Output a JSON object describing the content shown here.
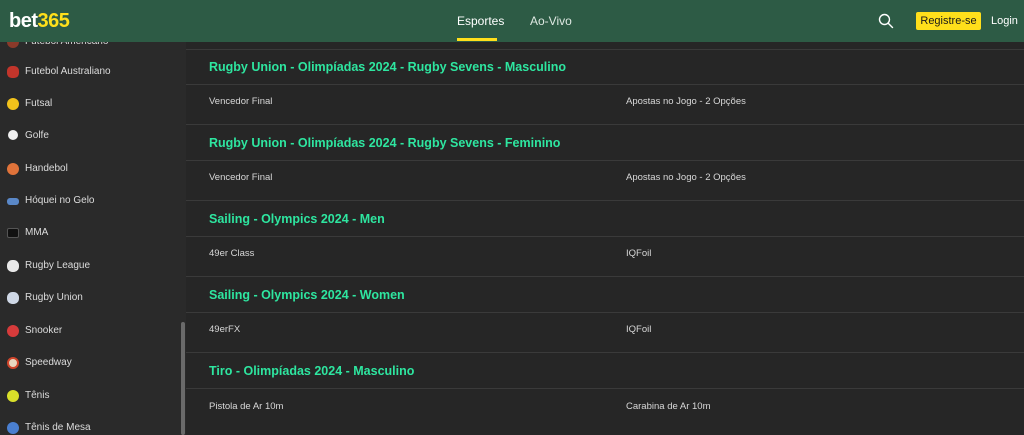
{
  "header": {
    "logo_part1": "bet",
    "logo_part2": "365",
    "tabs": [
      {
        "label": "Esportes",
        "active": true
      },
      {
        "label": "Ao-Vivo",
        "active": false
      }
    ],
    "search_icon": "search-icon",
    "register_label": "Registre-se",
    "login_label": "Login",
    "colors": {
      "bar": "#2d5b45",
      "accent": "#ffdf1b"
    }
  },
  "sidebar": {
    "items": [
      {
        "label": "Futebol Americano",
        "icon": "american-football-icon"
      },
      {
        "label": "Futebol Australiano",
        "icon": "australian-football-icon"
      },
      {
        "label": "Futsal",
        "icon": "futsal-ball-icon"
      },
      {
        "label": "Golfe",
        "icon": "golf-icon"
      },
      {
        "label": "Handebol",
        "icon": "handball-icon"
      },
      {
        "label": "Hóquei no Gelo",
        "icon": "ice-hockey-puck-icon"
      },
      {
        "label": "MMA",
        "icon": "mma-icon"
      },
      {
        "label": "Rugby League",
        "icon": "rugby-league-ball-icon"
      },
      {
        "label": "Rugby Union",
        "icon": "rugby-union-ball-icon"
      },
      {
        "label": "Snooker",
        "icon": "snooker-icon"
      },
      {
        "label": "Speedway",
        "icon": "speedway-helmet-icon"
      },
      {
        "label": "Tênis",
        "icon": "tennis-ball-icon"
      },
      {
        "label": "Tênis de Mesa",
        "icon": "table-tennis-icon"
      }
    ]
  },
  "competitions": [
    {
      "title": "Rugby Union - Olimpíadas 2024 - Rugby Sevens - Masculino",
      "markets": [
        "Vencedor Final",
        "Apostas no Jogo - 2 Opções"
      ]
    },
    {
      "title": "Rugby Union - Olimpíadas 2024 - Rugby Sevens - Feminino",
      "markets": [
        "Vencedor Final",
        "Apostas no Jogo - 2 Opções"
      ]
    },
    {
      "title": "Sailing - Olympics 2024 - Men",
      "markets": [
        "49er Class",
        "IQFoil"
      ]
    },
    {
      "title": "Sailing - Olympics 2024 - Women",
      "markets": [
        "49erFX",
        "IQFoil"
      ]
    },
    {
      "title": "Tiro - Olimpíadas 2024 - Masculino",
      "markets": [
        "Pistola de Ar 10m",
        "Carabina de Ar 10m"
      ]
    }
  ],
  "colors": {
    "competition_title": "#2ee6a0",
    "background": "#262626",
    "sidebar": "#2a2a2a"
  }
}
